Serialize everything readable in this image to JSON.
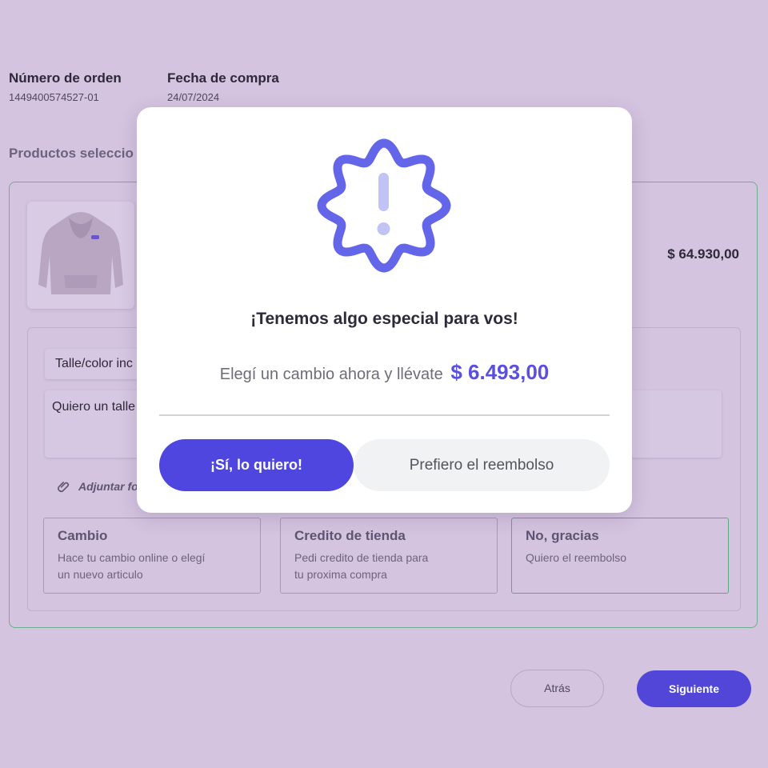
{
  "order": {
    "number_label": "Número de orden",
    "number_value": "1449400574527-01",
    "date_label": "Fecha de compra",
    "date_value": "24/07/2024"
  },
  "products": {
    "section_title": "Productos seleccio",
    "price": "$ 64.930,00",
    "reason_value": "Talle/color inc",
    "comment_value": "Quiero un talle",
    "attach_label": "Adjuntar fo"
  },
  "options": [
    {
      "title": "Cambio",
      "desc_line1": "Hace tu cambio online o elegí",
      "desc_line2": "un nuevo articulo"
    },
    {
      "title": "Credito de tienda",
      "desc_line1": "Pedi credito de tienda para",
      "desc_line2": "tu proxima compra"
    },
    {
      "title": "No, gracias",
      "desc_line1": "Quiero el reembolso",
      "desc_line2": ""
    }
  ],
  "footer": {
    "back_label": "Atrás",
    "next_label": "Siguiente"
  },
  "modal": {
    "title": "¡Tenemos algo especial para vos!",
    "text": "Elegí un cambio ahora y llévate",
    "amount": "$ 6.493,00",
    "yes_label": "¡Sí, lo quiero!",
    "refund_label": "Prefiero el reembolso",
    "icon": "alert-badge-icon"
  },
  "colors": {
    "overlay_bg": "#d4c4e0",
    "accent": "#4f46e0",
    "selected_border": "#5aa980"
  }
}
